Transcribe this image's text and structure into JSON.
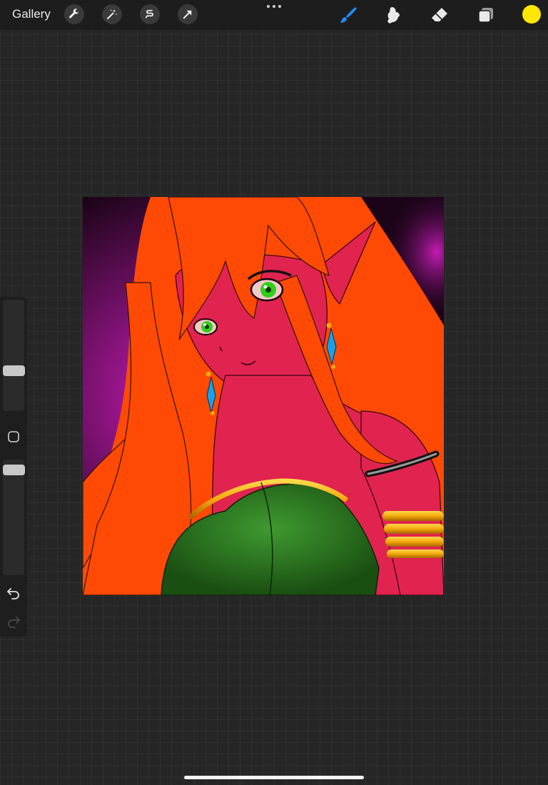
{
  "app": {
    "gallery_label": "Gallery"
  },
  "toolbar": {
    "left_tools": [
      "wrench-icon",
      "magic-wand-icon",
      "selection-s-icon",
      "transform-arrow-icon"
    ],
    "right_tools": [
      "brush-icon",
      "smudge-icon",
      "eraser-icon",
      "layers-icon"
    ],
    "active_tool": "brush",
    "active_tool_color": "#1e8bff"
  },
  "color": {
    "current": "#ffe600"
  },
  "sidebar": {
    "brush_size_level": 0.35,
    "opacity_level": 0.95
  },
  "canvas": {
    "palette": {
      "hair": "#ff4a05",
      "skin": "#e0244f",
      "background_glow": "#c41cb4",
      "background_dark": "#1c0418",
      "top": "#1a4f12",
      "gold": "#f3a90c",
      "eyes": "#2fcf1a",
      "earring": "#1aa0e6"
    }
  }
}
